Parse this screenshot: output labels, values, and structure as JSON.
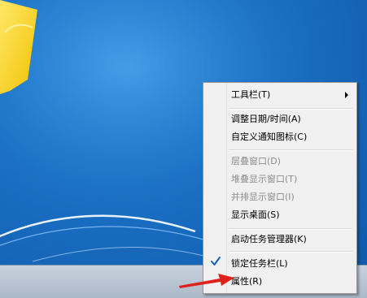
{
  "context_menu": {
    "items": [
      {
        "label": "工具栏(T)"
      },
      {
        "label": "调整日期/时间(A)"
      },
      {
        "label": "自定义通知图标(C)"
      },
      {
        "label": "层叠窗口(D)"
      },
      {
        "label": "堆叠显示窗口(T)"
      },
      {
        "label": "并排显示窗口(I)"
      },
      {
        "label": "显示桌面(S)"
      },
      {
        "label": "启动任务管理器(K)"
      },
      {
        "label": "锁定任务栏(L)"
      },
      {
        "label": "属性(R)"
      }
    ]
  },
  "icons": {
    "check": "check-icon",
    "submenu": "chevron-right-icon",
    "arrow": "red-arrow-icon"
  },
  "colors": {
    "desktop": "#1a6fc4",
    "arrow": "#e0211b",
    "check": "#1b5eb8"
  }
}
